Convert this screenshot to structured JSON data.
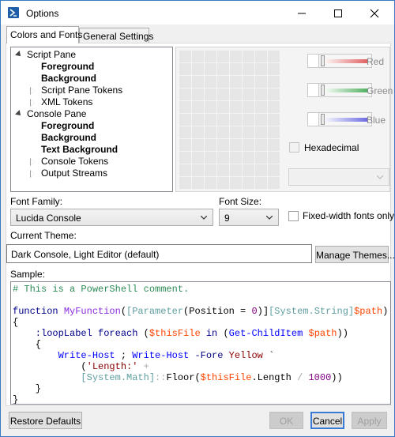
{
  "window": {
    "title": "Options"
  },
  "tabs": [
    {
      "label": "Colors and Fonts",
      "active": true
    },
    {
      "label": "General Settings",
      "active": false
    }
  ],
  "tree": {
    "items": [
      {
        "label": "Script Pane",
        "bold": false,
        "level": 0,
        "expanded": true
      },
      {
        "label": "Foreground",
        "bold": true,
        "level": 1
      },
      {
        "label": "Background",
        "bold": true,
        "level": 1
      },
      {
        "label": "Script Pane Tokens",
        "bold": false,
        "level": 1,
        "collapsed": true
      },
      {
        "label": "XML Tokens",
        "bold": false,
        "level": 1,
        "collapsed": true
      },
      {
        "label": "Console Pane",
        "bold": false,
        "level": 0,
        "expanded": true
      },
      {
        "label": "Foreground",
        "bold": true,
        "level": 1
      },
      {
        "label": "Background",
        "bold": true,
        "level": 1
      },
      {
        "label": "Text Background",
        "bold": true,
        "level": 1
      },
      {
        "label": "Console Tokens",
        "bold": false,
        "level": 1,
        "collapsed": true
      },
      {
        "label": "Output Streams",
        "bold": false,
        "level": 1,
        "collapsed": true
      }
    ]
  },
  "color_editor": {
    "channels": [
      {
        "label": "Red",
        "color": "#e06060"
      },
      {
        "label": "Green",
        "color": "#50b060"
      },
      {
        "label": "Blue",
        "color": "#6a6ae0"
      }
    ],
    "hexadecimal_label": "Hexadecimal"
  },
  "font": {
    "family_label": "Font Family:",
    "family_value": "Lucida Console",
    "size_label": "Font Size:",
    "size_value": "9",
    "fixed_width_label": "Fixed-width fonts only"
  },
  "theme": {
    "label": "Current Theme:",
    "value": "Dark Console, Light Editor (default)",
    "manage_button": "Manage Themes..."
  },
  "sample": {
    "label": "Sample:",
    "lines": [
      [
        [
          "c-comment",
          "# This is a PowerShell comment."
        ]
      ],
      [],
      [
        [
          "c-kw",
          "function "
        ],
        [
          "c-fn",
          "MyFunction"
        ],
        [
          "c-plain",
          "("
        ],
        [
          "c-type",
          "[Parameter"
        ],
        [
          "c-plain",
          "(Position = "
        ],
        [
          "c-num",
          "0"
        ],
        [
          "c-plain",
          ")]"
        ],
        [
          "c-type",
          "[System.String]"
        ],
        [
          "c-var",
          "$path"
        ],
        [
          "c-plain",
          ")"
        ]
      ],
      [
        [
          "c-plain",
          "{"
        ]
      ],
      [
        [
          "c-label",
          "    :loopLabel "
        ],
        [
          "c-kw",
          "foreach "
        ],
        [
          "c-plain",
          "("
        ],
        [
          "c-var",
          "$thisFile "
        ],
        [
          "c-kw",
          "in "
        ],
        [
          "c-plain",
          "("
        ],
        [
          "c-cmd",
          "Get-ChildItem "
        ],
        [
          "c-var",
          "$path"
        ],
        [
          "c-plain",
          "))"
        ]
      ],
      [
        [
          "c-plain",
          "    {"
        ]
      ],
      [
        [
          "c-cmd",
          "        Write-Host "
        ],
        [
          "c-plain",
          "; "
        ],
        [
          "c-cmd",
          "Write-Host "
        ],
        [
          "c-param",
          "-Fore "
        ],
        [
          "c-str",
          "Yellow "
        ],
        [
          "c-plain",
          "`"
        ]
      ],
      [
        [
          "c-plain",
          "            ("
        ],
        [
          "c-str",
          "'Length:'"
        ],
        [
          "c-op",
          " +"
        ]
      ],
      [
        [
          "c-type",
          "            [System.Math]"
        ],
        [
          "c-op",
          "::"
        ],
        [
          "c-plain",
          "Floor("
        ],
        [
          "c-var",
          "$thisFile"
        ],
        [
          "c-plain",
          ".Length "
        ],
        [
          "c-op",
          "/ "
        ],
        [
          "c-num",
          "1000"
        ],
        [
          "c-plain",
          "))"
        ]
      ],
      [
        [
          "c-plain",
          "    }"
        ]
      ],
      [
        [
          "c-plain",
          "}"
        ]
      ]
    ]
  },
  "footer": {
    "restore_defaults": "Restore Defaults",
    "ok": "OK",
    "cancel": "Cancel",
    "apply": "Apply"
  }
}
